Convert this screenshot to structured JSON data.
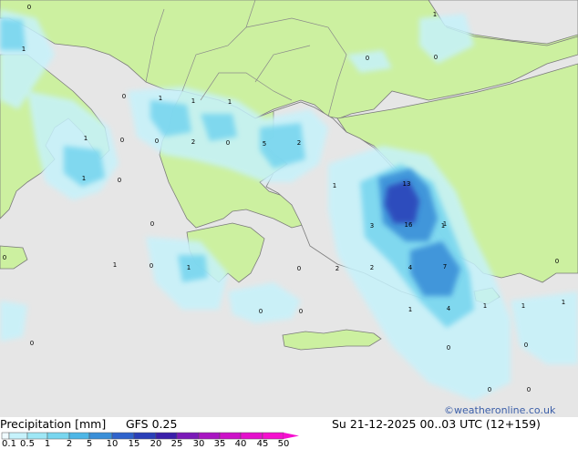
{
  "title_left": "Precipitation [mm]",
  "model": "GFS 0.25",
  "valid_time": "Su 21-12-2025 00..03 UTC (12+159)",
  "copyright": "©weatheronline.co.uk",
  "legend": {
    "ticks": [
      "0.1",
      "0.5",
      "1",
      "2",
      "5",
      "10",
      "15",
      "20",
      "25",
      "30",
      "35",
      "40",
      "45",
      "50"
    ],
    "colors": [
      "#f0fbff",
      "#c6f2fb",
      "#9ee7f5",
      "#78d6ef",
      "#4db6e6",
      "#3a8fd8",
      "#2f63cc",
      "#2a3fb8",
      "#3a1faa",
      "#7a1ab8",
      "#a815c2",
      "#cc12c8",
      "#e410cc",
      "#f50fcf"
    ]
  },
  "map_colors": {
    "sea": "#e6e6e6",
    "land": "#ccf0a0",
    "border": "#8a8a8a",
    "coast": "#7a7a7a"
  },
  "map_labels": [
    "0",
    "1",
    "0",
    "1",
    "1",
    "1",
    "0",
    "0",
    "2",
    "0",
    "1",
    "0",
    "5",
    "2",
    "1",
    "0",
    "1",
    "1",
    "0",
    "0",
    "1",
    "0",
    "1",
    "0",
    "1",
    "0",
    "13",
    "3",
    "16",
    "1",
    "2",
    "4",
    "7",
    "1",
    "4",
    "1",
    "1",
    "0",
    "0",
    "0",
    "0",
    "0",
    "1",
    "0",
    "0",
    "2",
    "0"
  ]
}
